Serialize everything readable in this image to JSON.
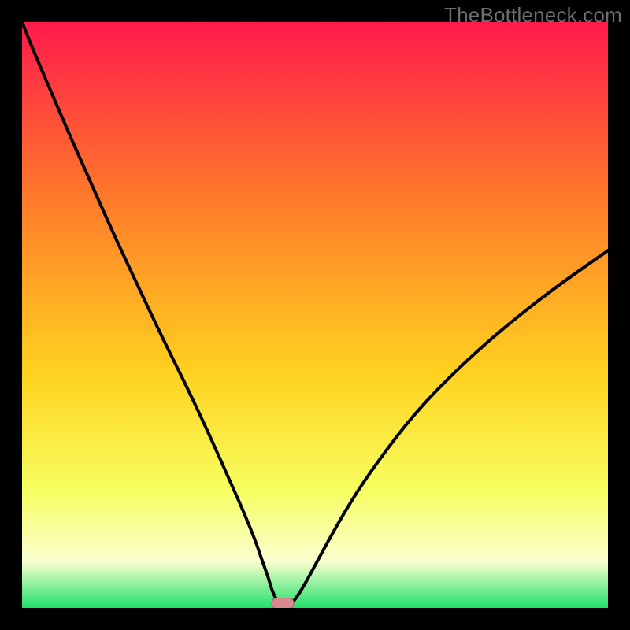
{
  "watermark": "TheBottleneck.com",
  "colors": {
    "frame": "#000000",
    "watermark": "#6e6e6e",
    "curve": "#000000",
    "marker_fill": "#d98a8e",
    "marker_stroke": "#b95a5e",
    "gradient_top": "#ff1a4c",
    "gradient_upper_mid": "#ff7a2a",
    "gradient_mid": "#ffd21f",
    "gradient_lower_mid": "#f6ff60",
    "gradient_pale": "#fbffd0",
    "gradient_bottom": "#22e06a"
  },
  "chart_data": {
    "type": "line",
    "title": "",
    "xlabel": "",
    "ylabel": "",
    "xlim": [
      0,
      100
    ],
    "ylim": [
      0,
      100
    ],
    "series": [
      {
        "name": "bottleneck-curve",
        "x": [
          0,
          2,
          5,
          8,
          12,
          16,
          20,
          24,
          28,
          32,
          36,
          38,
          40,
          41,
          42,
          42.5,
          43,
          43.5,
          44,
          44.5,
          45,
          46,
          48,
          52,
          56,
          60,
          66,
          72,
          80,
          90,
          100
        ],
        "y": [
          100,
          95,
          88,
          81,
          72,
          63,
          54.5,
          46,
          38,
          29.5,
          20.5,
          16,
          11,
          8,
          5.3,
          3.5,
          2.2,
          1.3,
          0.6,
          0.25,
          0.1,
          0.6,
          3.5,
          11,
          18,
          24,
          32,
          38.5,
          46,
          54,
          61
        ],
        "min_x": 44.5,
        "min_y": 0.25
      }
    ],
    "marker": {
      "x": 44.5,
      "y": 0.25
    },
    "gradient_steps": [
      {
        "pct": 0,
        "color_key": "gradient_top"
      },
      {
        "pct": 30,
        "color_key": "gradient_upper_mid"
      },
      {
        "pct": 60,
        "color_key": "gradient_mid"
      },
      {
        "pct": 80,
        "color_key": "gradient_lower_mid"
      },
      {
        "pct": 92,
        "color_key": "gradient_pale"
      },
      {
        "pct": 100,
        "color_key": "gradient_bottom"
      }
    ]
  }
}
